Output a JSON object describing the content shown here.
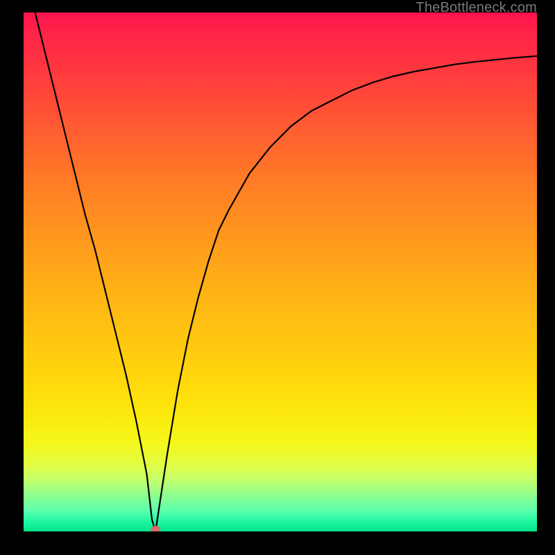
{
  "watermark": "TheBottleneck.com",
  "colors": {
    "gradient_top": "#ff124e",
    "gradient_bottom": "#00e58b",
    "curve": "#000000",
    "marker": "#d86a6a",
    "frame": "#000000"
  },
  "chart_data": {
    "type": "line",
    "title": "",
    "xlabel": "",
    "ylabel": "",
    "xlim": [
      0,
      100
    ],
    "ylim": [
      0,
      100
    ],
    "grid": false,
    "legend": false,
    "series": [
      {
        "name": "bottleneck-curve",
        "x": [
          0,
          2,
          4,
          6,
          8,
          10,
          12,
          14,
          16,
          18,
          20,
          22,
          24,
          25.0,
          25.7,
          26,
          28,
          30,
          32,
          34,
          36,
          38,
          40,
          44,
          48,
          52,
          56,
          60,
          64,
          68,
          72,
          76,
          80,
          84,
          88,
          92,
          96,
          100
        ],
        "values": [
          110,
          101,
          93,
          85,
          77,
          69,
          61,
          54,
          46,
          38,
          30,
          21,
          11,
          2.3,
          0.0,
          2,
          15,
          27,
          37,
          45,
          52,
          58,
          62,
          69,
          74,
          78,
          81,
          83,
          85,
          86.5,
          87.7,
          88.6,
          89.3,
          90.0,
          90.5,
          90.9,
          91.3,
          91.6
        ]
      }
    ],
    "marker": {
      "x": 25.7,
      "y": 0.0
    }
  }
}
